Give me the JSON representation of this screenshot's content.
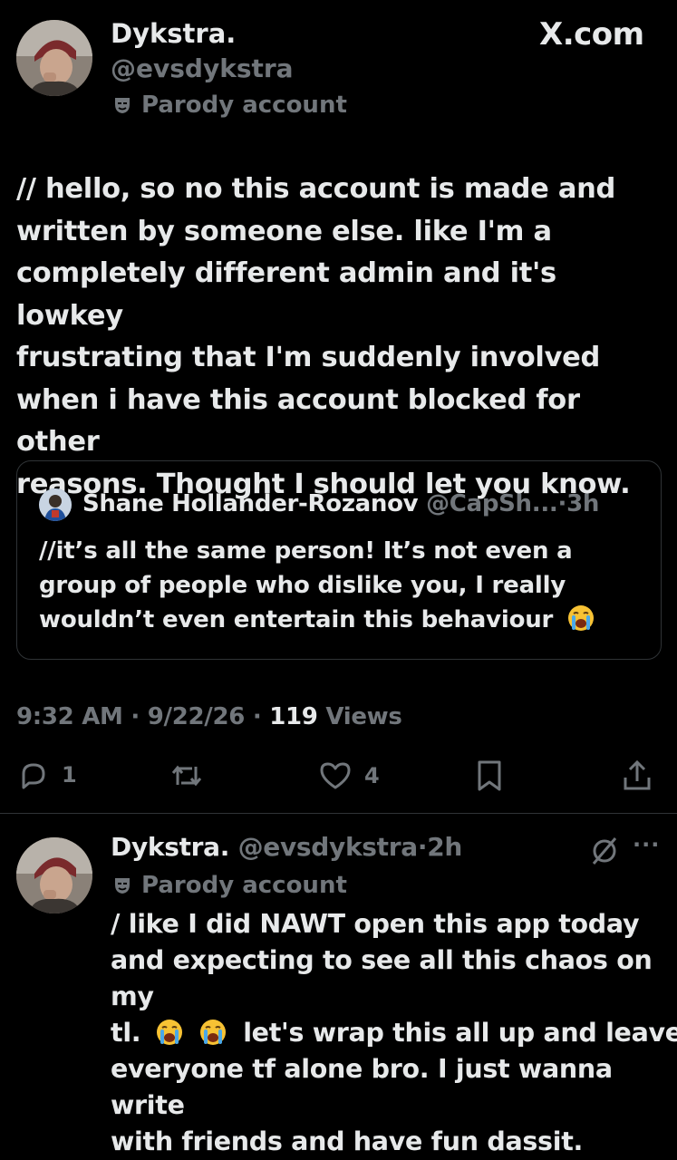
{
  "header": {
    "brand": "X.com"
  },
  "main_tweet": {
    "display_name": "Dykstra.",
    "handle": "@evsdykstra",
    "parody_label": "Parody account",
    "text_lines": [
      "// hello, so no this account is made and",
      "written by someone else. like I'm a",
      "completely different admin and it's lowkey",
      "frustrating that I'm suddenly involved",
      "when i have this account blocked for other",
      "reasons. Thought I should let you know."
    ],
    "quote": {
      "display_name": "Shane Hollander-Rozanov",
      "handle": "@CapSh...",
      "time": "3h",
      "text_lines": [
        "//it’s all the same person! It’s not even a",
        "group of people who dislike you, I really",
        "wouldn’t even entertain this behaviour"
      ]
    },
    "meta": {
      "time": "9:32 AM",
      "date": "9/22/26",
      "views_count": "119",
      "views_label": "Views"
    },
    "actions": {
      "replies": "1",
      "likes": "4"
    }
  },
  "reply_tweet": {
    "display_name": "Dykstra.",
    "handle": "@evsdykstra",
    "time": "2h",
    "parody_label": "Parody account",
    "text_lines": [
      "/ like I did NAWT open this app today",
      "and expecting to see all this chaos on my",
      "tl.",
      "let's wrap this all up and leave",
      "everyone tf alone bro. I just wanna write",
      "with friends and have fun dassit."
    ]
  },
  "colors": {
    "background": "#000000",
    "text": "#e7e9ea",
    "muted": "#71767b",
    "border": "#2f3336"
  },
  "icons": [
    "mask-icon",
    "reply-icon",
    "retweet-icon",
    "heart-icon",
    "bookmark-icon",
    "share-icon",
    "grok-icon",
    "more-icon",
    "crying-emoji"
  ]
}
